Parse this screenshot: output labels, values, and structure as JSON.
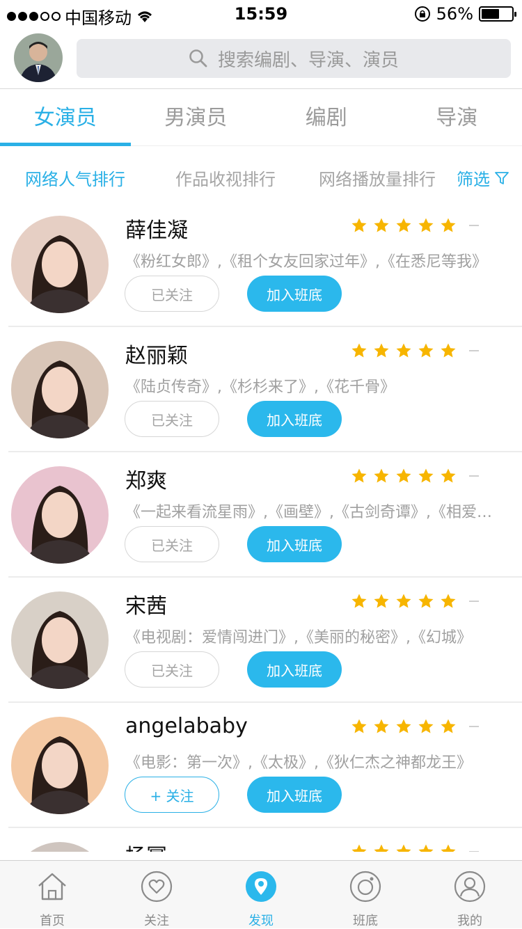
{
  "status_bar": {
    "carrier": "中国移动",
    "time": "15:59",
    "battery": "56%",
    "battery_level": 0.56
  },
  "search": {
    "placeholder": "搜索编剧、导演、演员"
  },
  "tabs": [
    {
      "label": "女演员",
      "active": true
    },
    {
      "label": "男演员",
      "active": false
    },
    {
      "label": "编剧",
      "active": false
    },
    {
      "label": "导演",
      "active": false
    }
  ],
  "sorts": [
    {
      "label": "网络人气排行",
      "active": true
    },
    {
      "label": "作品收视排行",
      "active": false
    },
    {
      "label": "网络播放量排行",
      "active": false
    }
  ],
  "filter_label": "筛选",
  "actors": [
    {
      "name": "薛佳凝",
      "works": "《粉红女郎》,《租个女友回家过年》,《在悉尼等我》",
      "rating": 5,
      "follow_label": "已关注",
      "followed": true,
      "add_label": "加入班底",
      "avatar_color": "#e6cfc4"
    },
    {
      "name": "赵丽颖",
      "works": "《陆贞传奇》,《杉杉来了》,《花千骨》",
      "rating": 5,
      "follow_label": "已关注",
      "followed": true,
      "add_label": "加入班底",
      "avatar_color": "#d9c6b8"
    },
    {
      "name": "郑爽",
      "works": "《一起来看流星雨》,《画壁》,《古剑奇谭》,《相爱十年》",
      "rating": 5,
      "follow_label": "已关注",
      "followed": true,
      "add_label": "加入班底",
      "avatar_color": "#e9c3cf"
    },
    {
      "name": "宋茜",
      "works": "《电视剧：爱情闯进门》,《美丽的秘密》,《幻城》",
      "rating": 5,
      "follow_label": "已关注",
      "followed": true,
      "add_label": "加入班底",
      "avatar_color": "#d8d0c7"
    },
    {
      "name": "angelababy",
      "works": "《电影：第一次》,《太极》,《狄仁杰之神都龙王》",
      "rating": 5,
      "follow_label": "+ 关注",
      "followed": false,
      "add_label": "加入班底",
      "avatar_color": "#f4c9a4"
    },
    {
      "name": "杨幂",
      "works": "",
      "rating": 5,
      "follow_label": "",
      "followed": false,
      "add_label": "",
      "avatar_color": "#cfc5bf"
    }
  ],
  "tabbar": [
    {
      "label": "首页",
      "icon": "home-icon",
      "active": false
    },
    {
      "label": "关注",
      "icon": "heart-icon",
      "active": false
    },
    {
      "label": "发现",
      "icon": "location-icon",
      "active": true
    },
    {
      "label": "班底",
      "icon": "lens-icon",
      "active": false
    },
    {
      "label": "我的",
      "icon": "user-icon",
      "active": false
    }
  ]
}
